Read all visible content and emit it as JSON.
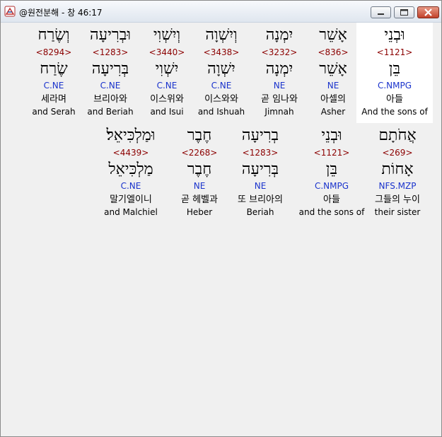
{
  "window": {
    "title": "@원전분해 - 창 46:17"
  },
  "rows": [
    {
      "words": [
        {
          "hebrew": "וּבְנֵי",
          "strong": "<1121>",
          "lexeme": "בֵּן",
          "morph": "C.NMPG",
          "korean": "아들",
          "english": "And the sons of",
          "selected": true
        },
        {
          "hebrew": "אָשֵׁר",
          "strong": "<836>",
          "lexeme": "אָשֵׁר",
          "morph": "NE",
          "korean": "아셀의",
          "english": "Asher",
          "selected": false
        },
        {
          "hebrew": "יִמְנָה",
          "strong": "<3232>",
          "lexeme": "יִמְנָה",
          "morph": "NE",
          "korean": "곧 임나와",
          "english": "Jimnah",
          "selected": false
        },
        {
          "hebrew": "וְיִשְׁוָה",
          "strong": "<3438>",
          "lexeme": "יִשְׁוָה",
          "morph": "C.NE",
          "korean": "이스와와",
          "english": "and Ishuah",
          "selected": false
        },
        {
          "hebrew": "וְיִשְׁוִי",
          "strong": "<3440>",
          "lexeme": "יִשְׁוִי",
          "morph": "C.NE",
          "korean": "이스위와",
          "english": "and Isui",
          "selected": false
        },
        {
          "hebrew": "וּבְרִיעָה",
          "strong": "<1283>",
          "lexeme": "בְּרִיעָה",
          "morph": "C.NE",
          "korean": "브리아와",
          "english": "and Beriah",
          "selected": false
        },
        {
          "hebrew": "וְשֶׂרַח",
          "strong": "<8294>",
          "lexeme": "שֶׂרַח",
          "morph": "C.NE",
          "korean": "세라며",
          "english": "and Serah",
          "selected": false
        }
      ]
    },
    {
      "words": [
        {
          "hebrew": "אֲחֹתָם",
          "strong": "<269>",
          "lexeme": "אָחוֹת",
          "morph": "NFS.MZP",
          "korean": "그들의 누이",
          "english": "their sister",
          "selected": false
        },
        {
          "hebrew": "וּבְנֵי",
          "strong": "<1121>",
          "lexeme": "בֵּן",
          "morph": "C.NMPG",
          "korean": "아들",
          "english": "and the sons of",
          "selected": false
        },
        {
          "hebrew": "בְרִיעָה",
          "strong": "<1283>",
          "lexeme": "בְּרִיעָה",
          "morph": "NE",
          "korean": "또 브리아의",
          "english": "Beriah",
          "selected": false
        },
        {
          "hebrew": "חֶבֶר",
          "strong": "<2268>",
          "lexeme": "חֶבֶר",
          "morph": "NE",
          "korean": "곧 헤벨과",
          "english": "Heber",
          "selected": false
        },
        {
          "hebrew": "וּמַלְכִּיאֵל׃",
          "strong": "<4439>",
          "lexeme": "מַלְכִּיאֵל",
          "morph": "C.NE",
          "korean": "말기엘이니",
          "english": "and Malchiel",
          "selected": false
        }
      ]
    }
  ]
}
